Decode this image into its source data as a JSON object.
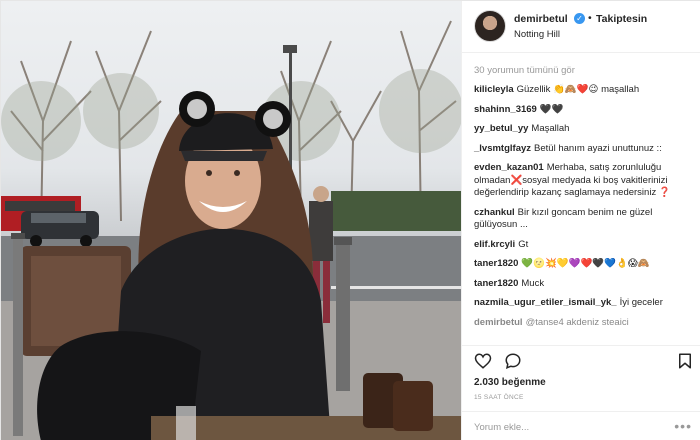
{
  "post": {
    "username": "demirbetul",
    "verified_icon": "verified-badge-icon",
    "separator": "•",
    "follow_label": "Takiptesin",
    "location": "Notting Hill",
    "view_all_comments": "30 yorumun tümünü gör",
    "comments": [
      {
        "user": "kilicleyla",
        "text": "Güzellik 👏🙈❤️😉 maşallah"
      },
      {
        "user": "shahinn_3169",
        "text": "🖤🖤"
      },
      {
        "user": "yy_betul_yy",
        "text": "Maşallah"
      },
      {
        "user": "_lvsmtglfayz",
        "text": "Betül hanım ayazi unuttunuz ::"
      },
      {
        "user": "evden_kazan01",
        "text": "Merhaba, satış zorunluluğu olmadan❌sosyal medyada ki boş vakitlerinizi değerlendirip kazanç saglamaya nedersiniz ❓"
      },
      {
        "user": "czhankul",
        "text": "Bir kızıl goncam benim ne güzel gülüyosun ..."
      },
      {
        "user": "elif.krcyli",
        "text": "Gt"
      },
      {
        "user": "taner1820",
        "text": "💚🌝💥💛💜❤️🖤💙👌😱🙈"
      },
      {
        "user": "taner1820",
        "text": "Muck"
      },
      {
        "user": "nazmila_ugur_etiler_ismail_yk_",
        "text": "İyi geceler"
      },
      {
        "user": "demirbetul",
        "text": "@tanse4 akdeniz steaici"
      }
    ],
    "likes": "2.030 beğenme",
    "time_ago": "15 SAAT ÖNCE",
    "comment_placeholder": "Yorum ekle...",
    "more_label": "•••",
    "icons": {
      "like": "heart-icon",
      "comment": "comment-icon",
      "save": "bookmark-icon"
    }
  }
}
